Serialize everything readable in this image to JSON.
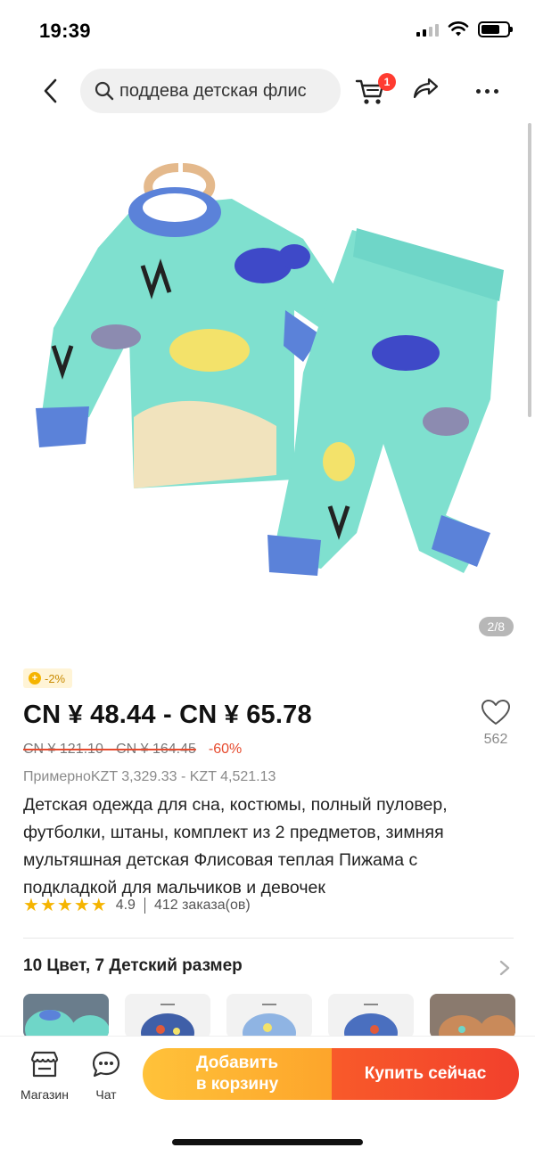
{
  "status_bar": {
    "time": "19:39"
  },
  "top_nav": {
    "search_text": "поддева детская флис",
    "cart_badge": "1"
  },
  "product": {
    "image_counter": "2/8",
    "discount_chip": "-2%",
    "price": "CN ¥  48.44 - CN ¥  65.78",
    "old_price": "CN ¥  121.10 - CN ¥  164.45",
    "discount_percent": "-60%",
    "approx_price": "ПримерноKZT 3,329.33 - KZT 4,521.13",
    "title": "Детская одежда для сна, костюмы, полный пуловер, футболки, штаны, комплект из 2 предметов, зимняя мультяшная детская Флисовая теплая Пижама с подкладкой для мальчиков и девочек",
    "rating": 4.9,
    "rating_text": "4.9",
    "orders": "412 заказа(ов)",
    "wishlist_count": "562",
    "variants_title": "10 Цвет, 7 Детский размер"
  },
  "colors": {
    "accent_orange": "#f2402c",
    "accent_yellow": "#fdb22f",
    "pajama_mint": "#6fd6c8",
    "cuff_blue": "#4f7fd8"
  },
  "bottom_bar": {
    "shop_label": "Магазин",
    "chat_label": "Чат",
    "add_to_cart_line1": "Добавить",
    "add_to_cart_line2": "в корзину",
    "buy_now_label": "Купить сейчас"
  }
}
